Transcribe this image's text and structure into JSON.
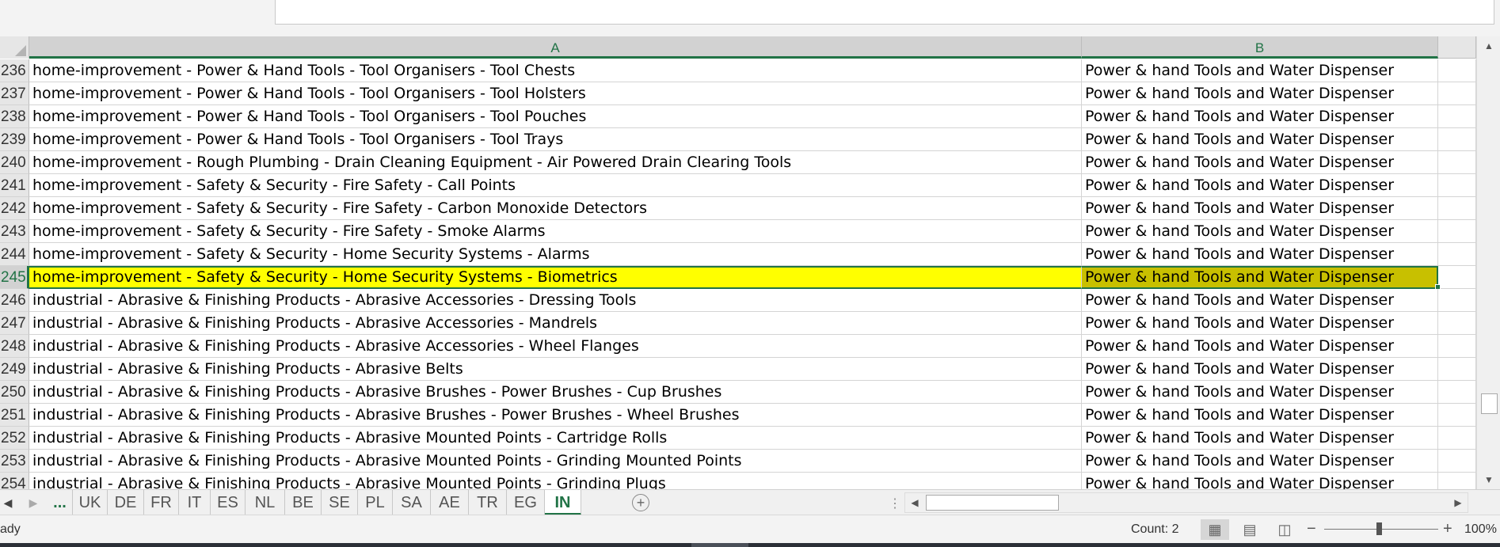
{
  "formula_bar": {
    "content": ""
  },
  "columns": [
    {
      "id": "A",
      "label": "A",
      "selected": true
    },
    {
      "id": "B",
      "label": "B",
      "selected": true
    }
  ],
  "rows": [
    {
      "num": "236",
      "a": "home-improvement - Power & Hand Tools - Tool Organisers - Tool Chests",
      "b": "Power & hand Tools and Water Dispenser",
      "selected": false
    },
    {
      "num": "237",
      "a": "home-improvement - Power & Hand Tools - Tool Organisers - Tool Holsters",
      "b": "Power & hand Tools and Water Dispenser",
      "selected": false
    },
    {
      "num": "238",
      "a": "home-improvement - Power & Hand Tools - Tool Organisers - Tool Pouches",
      "b": "Power & hand Tools and Water Dispenser",
      "selected": false
    },
    {
      "num": "239",
      "a": "home-improvement - Power & Hand Tools - Tool Organisers - Tool Trays",
      "b": "Power & hand Tools and Water Dispenser",
      "selected": false
    },
    {
      "num": "240",
      "a": "home-improvement - Rough Plumbing - Drain Cleaning Equipment - Air Powered Drain Clearing Tools",
      "b": "Power & hand Tools and Water Dispenser",
      "selected": false
    },
    {
      "num": "241",
      "a": "home-improvement - Safety & Security - Fire Safety - Call Points",
      "b": "Power & hand Tools and Water Dispenser",
      "selected": false
    },
    {
      "num": "242",
      "a": "home-improvement - Safety & Security - Fire Safety - Carbon Monoxide Detectors",
      "b": "Power & hand Tools and Water Dispenser",
      "selected": false
    },
    {
      "num": "243",
      "a": "home-improvement - Safety & Security - Fire Safety - Smoke Alarms",
      "b": "Power & hand Tools and Water Dispenser",
      "selected": false
    },
    {
      "num": "244",
      "a": "home-improvement - Safety & Security - Home Security Systems - Alarms",
      "b": "Power & hand Tools and Water Dispenser",
      "selected": false
    },
    {
      "num": "245",
      "a": "home-improvement - Safety & Security - Home Security Systems - Biometrics",
      "b": "Power & hand Tools and Water Dispenser",
      "selected": true
    },
    {
      "num": "246",
      "a": "industrial - Abrasive & Finishing Products - Abrasive Accessories - Dressing Tools",
      "b": "Power & hand Tools and Water Dispenser",
      "selected": false
    },
    {
      "num": "247",
      "a": "industrial - Abrasive & Finishing Products - Abrasive Accessories - Mandrels",
      "b": "Power & hand Tools and Water Dispenser",
      "selected": false
    },
    {
      "num": "248",
      "a": "industrial - Abrasive & Finishing Products - Abrasive Accessories - Wheel Flanges",
      "b": "Power & hand Tools and Water Dispenser",
      "selected": false
    },
    {
      "num": "249",
      "a": "industrial - Abrasive & Finishing Products - Abrasive Belts",
      "b": "Power & hand Tools and Water Dispenser",
      "selected": false
    },
    {
      "num": "250",
      "a": "industrial - Abrasive & Finishing Products - Abrasive Brushes - Power Brushes - Cup Brushes",
      "b": "Power & hand Tools and Water Dispenser",
      "selected": false
    },
    {
      "num": "251",
      "a": "industrial - Abrasive & Finishing Products - Abrasive Brushes - Power Brushes - Wheel Brushes",
      "b": "Power & hand Tools and Water Dispenser",
      "selected": false
    },
    {
      "num": "252",
      "a": "industrial - Abrasive & Finishing Products - Abrasive Mounted Points - Cartridge Rolls",
      "b": "Power & hand Tools and Water Dispenser",
      "selected": false
    },
    {
      "num": "253",
      "a": "industrial - Abrasive & Finishing Products - Abrasive Mounted Points - Grinding Mounted Points",
      "b": "Power & hand Tools and Water Dispenser",
      "selected": false
    },
    {
      "num": "254",
      "a": "industrial - Abrasive & Finishing Products - Abrasive Mounted Points - Grinding Plugs",
      "b": "Power & hand Tools and Water Dispenser",
      "selected": false
    }
  ],
  "sheet_tabs": {
    "more_label": "...",
    "tabs": [
      "UK",
      "DE",
      "FR",
      "IT",
      "ES",
      "NL",
      "BE",
      "SE",
      "PL",
      "SA",
      "AE",
      "TR",
      "EG",
      "IN"
    ],
    "active": "IN",
    "add_icon": "plus-circle-icon"
  },
  "status_bar": {
    "status_text": "ady",
    "count_label": "Count: 2",
    "zoom_level": "100%",
    "zoom_fraction": 0.5
  },
  "colors": {
    "accent": "#217346",
    "selected_row_fill": "#ffff00",
    "selected_b_fill": "#c8c000"
  }
}
